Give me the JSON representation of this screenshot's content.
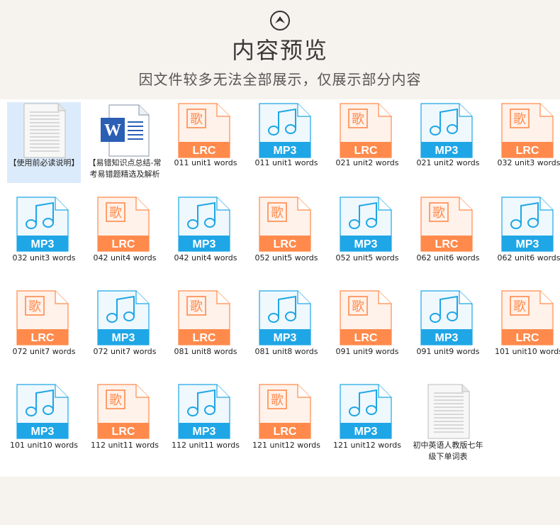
{
  "header": {
    "title": "内容预览",
    "subtitle": "因文件较多无法全部展示，仅展示部分内容",
    "icon": "chevron-up-circle-icon"
  },
  "colors": {
    "lrc": "#ff8a4c",
    "lrc_light": "#fff2ea",
    "mp3": "#1fa6e6",
    "mp3_light": "#eef8fd",
    "word": "#2b5fb4",
    "selected": "#dcebfb"
  },
  "files": [
    {
      "type": "txt",
      "label": "【使用前必读说明】",
      "selected": true
    },
    {
      "type": "word",
      "label": "【易错知识点总结-常考易错题精选及解析"
    },
    {
      "type": "lrc",
      "badge": "LRC",
      "glyph": "歌",
      "label": "011 unit1 words"
    },
    {
      "type": "mp3",
      "badge": "MP3",
      "label": "011 unit1 words"
    },
    {
      "type": "lrc",
      "badge": "LRC",
      "glyph": "歌",
      "label": "021 unit2 words"
    },
    {
      "type": "mp3",
      "badge": "MP3",
      "label": "021 unit2 words"
    },
    {
      "type": "lrc",
      "badge": "LRC",
      "glyph": "歌",
      "label": "032 unit3 words"
    },
    {
      "type": "mp3",
      "badge": "MP3",
      "label": "032 unit3 words"
    },
    {
      "type": "lrc",
      "badge": "LRC",
      "glyph": "歌",
      "label": "042 unit4 words"
    },
    {
      "type": "mp3",
      "badge": "MP3",
      "label": "042 unit4 words"
    },
    {
      "type": "lrc",
      "badge": "LRC",
      "glyph": "歌",
      "label": "052 unit5 words"
    },
    {
      "type": "mp3",
      "badge": "MP3",
      "label": "052 unit5 words"
    },
    {
      "type": "lrc",
      "badge": "LRC",
      "glyph": "歌",
      "label": "062 unit6 words"
    },
    {
      "type": "mp3",
      "badge": "MP3",
      "label": "062 unit6 words"
    },
    {
      "type": "lrc",
      "badge": "LRC",
      "glyph": "歌",
      "label": "072 unit7 words"
    },
    {
      "type": "mp3",
      "badge": "MP3",
      "label": "072 unit7 words"
    },
    {
      "type": "lrc",
      "badge": "LRC",
      "glyph": "歌",
      "label": "081 unit8 words"
    },
    {
      "type": "mp3",
      "badge": "MP3",
      "label": "081 unit8 words"
    },
    {
      "type": "lrc",
      "badge": "LRC",
      "glyph": "歌",
      "label": "091 unit9 words"
    },
    {
      "type": "mp3",
      "badge": "MP3",
      "label": "091 unit9 words"
    },
    {
      "type": "lrc",
      "badge": "LRC",
      "glyph": "歌",
      "label": "101 unit10 words"
    },
    {
      "type": "mp3",
      "badge": "MP3",
      "label": "101 unit10 words"
    },
    {
      "type": "lrc",
      "badge": "LRC",
      "glyph": "歌",
      "label": "112 unit11 words"
    },
    {
      "type": "mp3",
      "badge": "MP3",
      "label": "112 unit11 words"
    },
    {
      "type": "lrc",
      "badge": "LRC",
      "glyph": "歌",
      "label": "121 unit12 words"
    },
    {
      "type": "mp3",
      "badge": "MP3",
      "label": "121 unit12 words"
    },
    {
      "type": "txt",
      "label": "初中英语人教版七年级下单词表"
    }
  ]
}
